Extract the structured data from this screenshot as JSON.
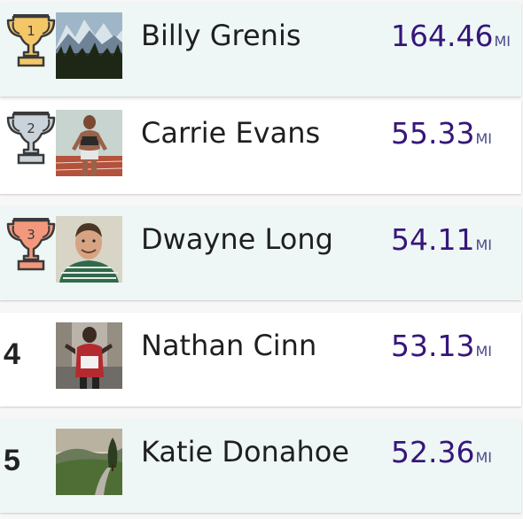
{
  "leaderboard": {
    "entries": [
      {
        "rank": "1",
        "trophy": "gold-trophy-icon",
        "trophy_color": "#f3c768",
        "name": "Billy Grenis",
        "distance": "164.46",
        "unit": "MI",
        "avatar": "mountain-forest-photo"
      },
      {
        "rank": "2",
        "trophy": "silver-trophy-icon",
        "trophy_color": "#c9d3d9",
        "name": "Carrie Evans",
        "distance": "55.33",
        "unit": "MI",
        "avatar": "runner-on-track-photo"
      },
      {
        "rank": "3",
        "trophy": "bronze-trophy-icon",
        "trophy_color": "#f3987c",
        "name": "Dwayne Long",
        "distance": "54.11",
        "unit": "MI",
        "avatar": "smiling-man-photo"
      },
      {
        "rank": "4",
        "name": "Nathan Cinn",
        "distance": "53.13",
        "unit": "MI",
        "avatar": "marathon-runner-photo"
      },
      {
        "rank": "5",
        "name": "Katie Donahoe",
        "distance": "52.36",
        "unit": "MI",
        "avatar": "hillside-road-photo"
      }
    ]
  },
  "colors": {
    "row_tint": "#eef7f5",
    "row_white": "#ffffff",
    "distance": "#36167a"
  }
}
